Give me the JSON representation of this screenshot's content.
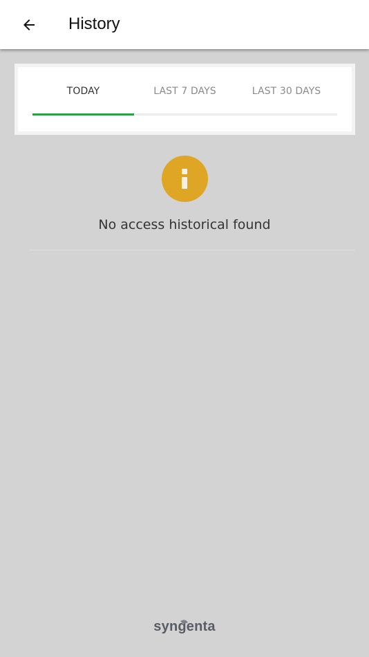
{
  "header": {
    "title": "History",
    "back_icon": "arrow-left-icon"
  },
  "tabs": [
    {
      "label": "TODAY",
      "active": true
    },
    {
      "label": "LAST 7 DAYS",
      "active": false
    },
    {
      "label": "LAST 30 DAYS",
      "active": false
    }
  ],
  "empty_state": {
    "icon": "info-icon",
    "message": "No access historical found"
  },
  "footer": {
    "brand": "syngenta"
  },
  "colors": {
    "background": "#d3d3d3",
    "tab_indicator": "#2aa243",
    "info_icon": "#dea624",
    "brand_text": "#585c64"
  }
}
